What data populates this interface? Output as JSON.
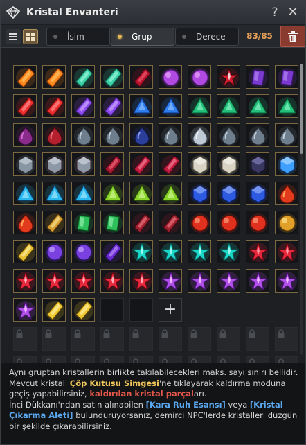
{
  "window": {
    "title": "Kristal Envanteri",
    "help_glyph": "?",
    "close_glyph": "✕"
  },
  "toolbar": {
    "tabs": [
      {
        "label": "İsim",
        "active": false
      },
      {
        "label": "Grup",
        "active": true
      },
      {
        "label": "Derece",
        "active": false
      }
    ],
    "count": "83/85"
  },
  "grid": {
    "add_glyph": "+",
    "rows": [
      [
        "orange-gem",
        "orange-gem",
        "teal-gem",
        "teal-gem",
        "redblack-gem",
        "purple-orb",
        "purple-orb",
        "redblack-star",
        "purple-flat",
        "purple-flat"
      ],
      [
        "red-shard",
        "red-shard",
        "purple-shard",
        "purple-shard",
        "blue-tri",
        "blue-tri",
        "green-eye",
        "green-eye",
        "green-eye",
        "green-eye"
      ],
      [
        "purple-drop",
        "red-drop",
        "gray-drop",
        "gray-drop",
        "navy-drop",
        "gray-drop",
        "white-drop",
        "gray-drop",
        "gray-drop",
        "gray-drop"
      ],
      [
        "gray-hex",
        "steel-tech",
        "steel-tech",
        "ruby-cluster",
        "ruby-shard",
        "ruby-shard",
        "white-hex",
        "white-hex",
        "dark-hex",
        "blue-diamond"
      ],
      [
        "cyan-tri",
        "cyan-tri",
        "cyan-tri",
        "lime-tri",
        "lime-tri",
        "lime-tri",
        "sapphire",
        "sapphire",
        "sapphire",
        "red-teardrop"
      ],
      [
        "red-teardrop",
        "gold-feather",
        "green-rect",
        "green-rect",
        "ruby-rock",
        "ruby-rock",
        "red-sphere",
        "red-sphere",
        "red-sphere",
        "gold-sphere"
      ],
      [
        "gold-spike",
        "purple-ball",
        "purple-ball",
        "violet-spike",
        "cyan-flower",
        "cyan-flower",
        "cyan-flower",
        "cyan-flower",
        "ruby-star",
        "ruby-star"
      ],
      [
        "red-star",
        "red-star",
        "red-star",
        "red-star",
        "red-star",
        "purple-flare",
        "purple-flare",
        "purple-flare",
        "purple-flare",
        "purple-flare"
      ],
      [
        "purple-flare",
        "gold-crystal",
        "gold-crystal",
        "empty",
        "empty",
        "add",
        "",
        "",
        "",
        ""
      ]
    ],
    "locked_rows": 3
  },
  "info": {
    "line1": "Aynı gruptan kristallerin birlikte takılabilecekleri maks. sayı sınırı bellidir.",
    "line2a": "Mevcut kristali ",
    "line2_highlight": "Çöp Kutusu Simgesi",
    "line2b": "'ne tıklayarak kaldırma moduna geçiş yapabilirsiniz, ",
    "line2_red": "kaldırılan kristal parçal",
    "line2c": "arı.",
    "line3a": "İnci Dükkanı'ndan satın alınabilen ",
    "line3_blue1": "[Kara Ruh Esansı]",
    "line3b": " veya ",
    "line3_blue2": "[Kristal Çıkarma Aleti]",
    "line3c": " bulunduruyorsanız, demirci NPC'lerde kristalleri düzgün bir şekilde çıkarabilirsiniz."
  }
}
